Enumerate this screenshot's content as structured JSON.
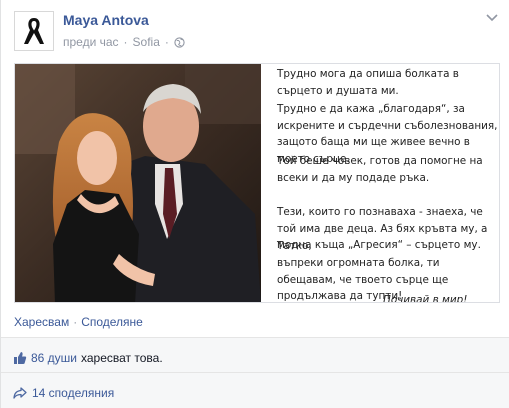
{
  "post": {
    "author": "Maya Antova",
    "time": "преди час",
    "separator": "·",
    "location": "Sofia",
    "separator2": "·"
  },
  "icons": {
    "avatar": "black-mourning-ribbon-icon",
    "privacy": "globe-icon",
    "menu": "chevron-down-icon",
    "like": "thumbs-up-icon",
    "share": "share-arrow-icon"
  },
  "letter": {
    "p1": "Трудно мога да опиша болката в сърцето и душата ми.",
    "p2": "Трудно е да кажа „благодаря“, за искрените и сърдечни съболезнования, защото баща ми ще живее вечно в моето сърце.",
    "p3": "Той беше човек, готов да помогне на всеки и да му подаде ръка.",
    "p4": "Тези, които го познаваха - знаеха, че той има две деца. Аз бях кръвта му, а модна къща „Агресия“ – сърцето му.",
    "p5": "Татко,",
    "p5b": "въпреки огромната болка, ти обещавам, че твоето сърце ще продължава да тупти!",
    "p6": "Почивай в мир!"
  },
  "actions": {
    "like": "Харесвам",
    "separator": "·",
    "share": "Споделяне"
  },
  "likes": {
    "count": "86 души",
    "text": "харесват това."
  },
  "shares": {
    "text": "14 споделяния"
  },
  "colors": {
    "link": "#3b5998",
    "meta": "#9197a3",
    "background_rows": "#f6f7f8"
  }
}
